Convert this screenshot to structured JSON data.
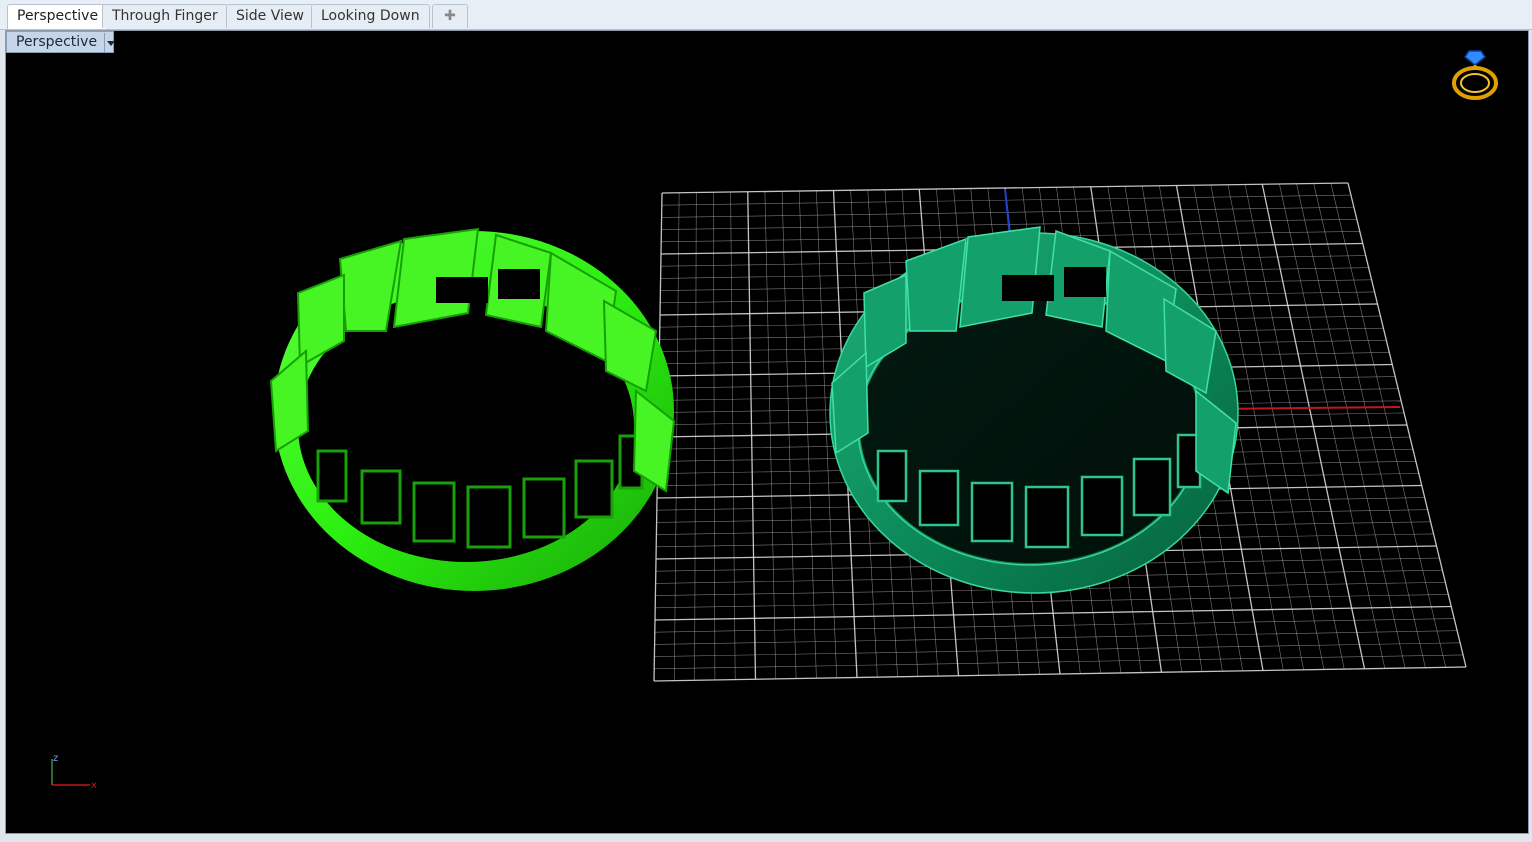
{
  "tabs": [
    {
      "label": "Perspective",
      "active": true
    },
    {
      "label": "Through Finger",
      "active": false
    },
    {
      "label": "Side View",
      "active": false
    },
    {
      "label": "Looking Down",
      "active": false
    }
  ],
  "add_tab_icon": "plus-icon",
  "viewport": {
    "label": "Perspective",
    "background": "#000000",
    "grid_color": "#d9d9d9",
    "axis_x_color": "#c0181a",
    "axis_y_color": "#1f3fd0"
  },
  "objects": {
    "ring_left_color": "#2cf010",
    "ring_right_color": "#0c8c5a"
  },
  "axes_icon": {
    "z": "z",
    "x": "x"
  },
  "badge_icon": "ring-icon"
}
